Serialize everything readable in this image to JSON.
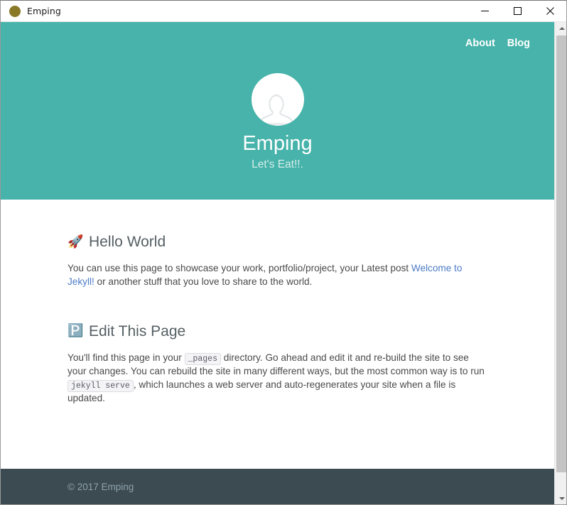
{
  "window": {
    "title": "Emping",
    "icon": "app-circle-icon",
    "controls": {
      "minimize": "—",
      "maximize": "□",
      "close": "✕"
    }
  },
  "site": {
    "header": {
      "background_color": "#47b3aa",
      "nav": [
        {
          "label": "About"
        },
        {
          "label": "Blog"
        }
      ],
      "avatar_alt": "avatar-placeholder",
      "title": "Emping",
      "tagline": "Let's Eat!!."
    },
    "posts": [
      {
        "emoji": "🚀",
        "emoji_name": "rocket-icon",
        "title": "Hello World",
        "body_parts": [
          {
            "type": "text",
            "value": "You can use this page to showcase your work, portfolio/project, your Latest post "
          },
          {
            "type": "link",
            "value": "Welcome to Jekyll!"
          },
          {
            "type": "text",
            "value": " or another stuff that you love to share to the world."
          }
        ]
      },
      {
        "emoji": "🅿️",
        "emoji_name": "parking-p-icon",
        "title": "Edit This Page",
        "body_parts": [
          {
            "type": "text",
            "value": "You'll find this page in your "
          },
          {
            "type": "code",
            "value": "_pages"
          },
          {
            "type": "text",
            "value": " directory. Go ahead and edit it and re-build the site to see your changes. You can rebuild the site in many different ways, but the most common way is to run "
          },
          {
            "type": "code",
            "value": "jekyll serve"
          },
          {
            "type": "text",
            "value": ", which launches a web server and auto-regenerates your site when a file is updated."
          }
        ]
      }
    ],
    "footer": {
      "copyright": "© 2017 Emping",
      "background_color": "#3c4a52"
    }
  },
  "scrollbar": {
    "up_arrow": "scroll-up-arrow",
    "down_arrow": "scroll-down-arrow"
  },
  "colors": {
    "accent_teal": "#47b3aa",
    "link_blue": "#4d7cc7",
    "footer_dark": "#3c4a52",
    "title_icon": "#8a7a28"
  }
}
